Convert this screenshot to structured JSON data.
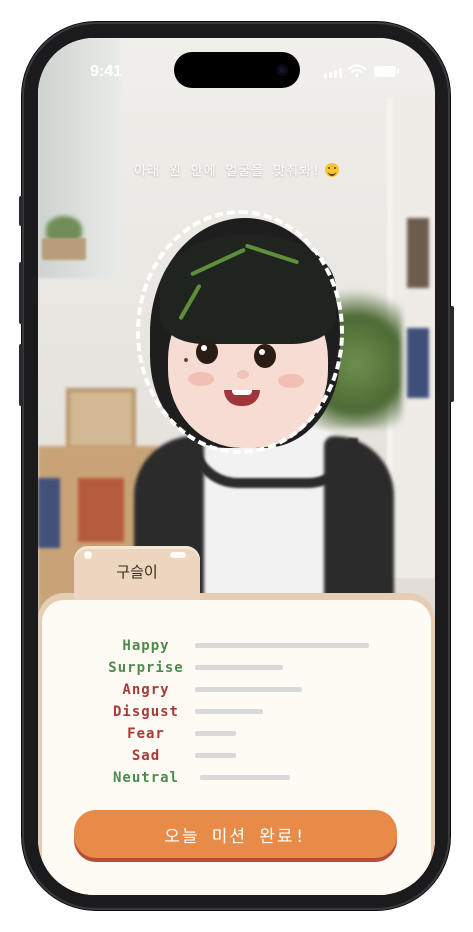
{
  "status_bar": {
    "time": "9:41"
  },
  "instruction": {
    "text": "아래 원 안에 얼굴을 맞춰봐!"
  },
  "profile": {
    "name": "구슬이"
  },
  "emotions": [
    {
      "label": "Happy",
      "color": "#4e8a4e",
      "level": 0.85
    },
    {
      "label": "Surprise",
      "color": "#4e8a4e",
      "level": 0.43
    },
    {
      "label": "Angry",
      "color": "#a83a3a",
      "level": 0.52
    },
    {
      "label": "Disgust",
      "color": "#a83a3a",
      "level": 0.33
    },
    {
      "label": "Fear",
      "color": "#a83a3a",
      "level": 0.2
    },
    {
      "label": "Sad",
      "color": "#a83a3a",
      "level": 0.2
    },
    {
      "label": "Neutral",
      "color": "#4e8a4e",
      "level": 0.44
    }
  ],
  "mission_button": {
    "label": "오늘 미션 완료!"
  },
  "colors": {
    "accent": "#e88b49",
    "card": "#fdfbf3",
    "tab": "#ecd6bf"
  }
}
